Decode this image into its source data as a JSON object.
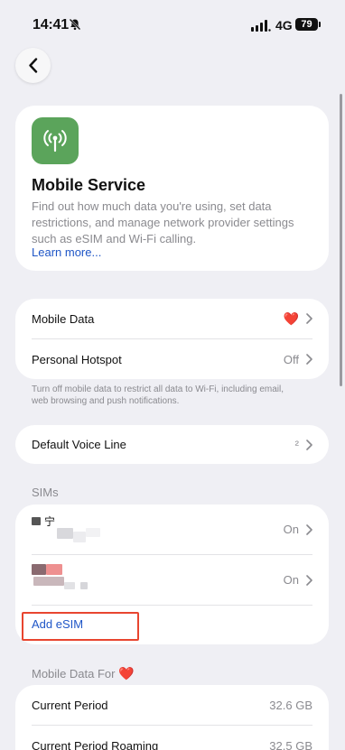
{
  "status_bar": {
    "time": "14:41",
    "network": "4G",
    "battery": "79"
  },
  "hero": {
    "title": "Mobile Service",
    "description": "Find out how much data you're using, set data restrictions, and manage network provider settings such as eSIM and Wi-Fi calling.",
    "learn_more": "Learn more...",
    "icon": "antenna-icon",
    "icon_color": "#5ba45b"
  },
  "data_group": {
    "mobile_data_label": "Mobile Data",
    "mobile_data_value": "❤️",
    "hotspot_label": "Personal Hotspot",
    "hotspot_value": "Off",
    "footnote": "Turn off mobile data to restrict all data to Wi-Fi, including email, web browsing and push notifications."
  },
  "voice_line": {
    "label": "Default Voice Line",
    "value": "²"
  },
  "sims": {
    "header": "SIMs",
    "items": [
      {
        "name": "宁",
        "status": "On"
      },
      {
        "name": "",
        "status": "On"
      }
    ],
    "add_label": "Add eSIM"
  },
  "usage": {
    "header": "Mobile Data For",
    "header_icon": "❤️",
    "rows": [
      {
        "label": "Current Period",
        "value": "32.6 GB"
      },
      {
        "label": "Current Period Roaming",
        "value": "32.5 GB"
      }
    ]
  },
  "colors": {
    "accent_link": "#1f56c7",
    "highlight": "#e8452f",
    "background": "#efeff4"
  }
}
